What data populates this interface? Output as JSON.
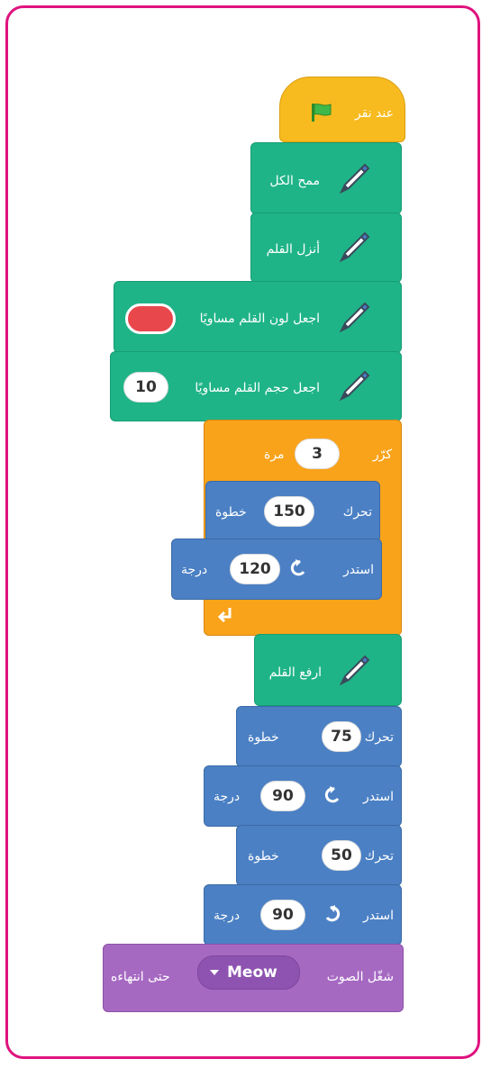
{
  "blocks": {
    "when_flag": {
      "text": "عند نقر"
    },
    "clear": {
      "text": "ممح الكل"
    },
    "pen_down": {
      "text": "أنزل القلم"
    },
    "set_color": {
      "text": "اجعل لون القلم مساويًا",
      "color": "#e8474c"
    },
    "set_size": {
      "text": "اجعل حجم القلم مساويًا",
      "value": "10"
    },
    "repeat": {
      "label": "كرّر",
      "value": "3",
      "suffix": "مرة"
    },
    "move1": {
      "label": "تحرك",
      "value": "150",
      "suffix": "خطوة"
    },
    "turn1": {
      "label": "استدر",
      "value": "120",
      "suffix": "درجة"
    },
    "pen_up": {
      "text": "ارفع القلم"
    },
    "move2": {
      "label": "تحرك",
      "value": "75",
      "suffix": "خطوة"
    },
    "turn2": {
      "label": "استدر",
      "value": "90",
      "suffix": "درجة"
    },
    "move3": {
      "label": "تحرك",
      "value": "50",
      "suffix": "خطوة"
    },
    "turn3": {
      "label": "استدر",
      "value": "90",
      "suffix": "درجة"
    },
    "play_sound": {
      "label": "شغّل الصوت",
      "sound": "Meow",
      "suffix": "حتى انتهاءه"
    }
  },
  "colors": {
    "events": "#f7bb1f",
    "pen": "#1fb487",
    "control": "#f9a31b",
    "motion": "#4b80c4",
    "sound": "#a669c2",
    "frame": "#e0127e"
  }
}
